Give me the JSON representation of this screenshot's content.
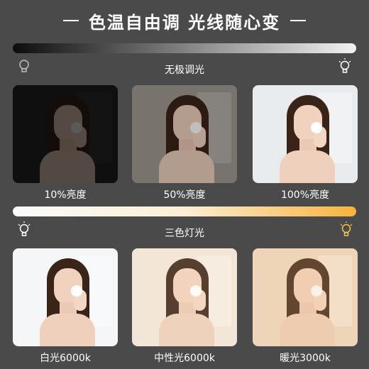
{
  "title": {
    "left_dash": "—",
    "text": "色温自由调 光线随心变",
    "right_dash": "—"
  },
  "brightness": {
    "label": "无极调光",
    "items": [
      {
        "caption": "10%亮度",
        "level": 0.1
      },
      {
        "caption": "50%亮度",
        "level": 0.5
      },
      {
        "caption": "100%亮度",
        "level": 1.0
      }
    ]
  },
  "color_temp": {
    "label": "三色灯光",
    "items": [
      {
        "caption": "白光6000k",
        "tint": "#ffffff"
      },
      {
        "caption": "中性光6000k",
        "tint": "#f7ead6"
      },
      {
        "caption": "暖光3000k",
        "tint": "#f5dcc0"
      }
    ]
  },
  "colors": {
    "background": "#4a4a4a",
    "dark_end": "#0c0c0c",
    "light_end": "#f2f2f2",
    "warm_end": "#f9b23c",
    "bulb_on": "#f6c34a"
  },
  "icons": [
    "bulb-off-icon",
    "bulb-on-icon"
  ]
}
